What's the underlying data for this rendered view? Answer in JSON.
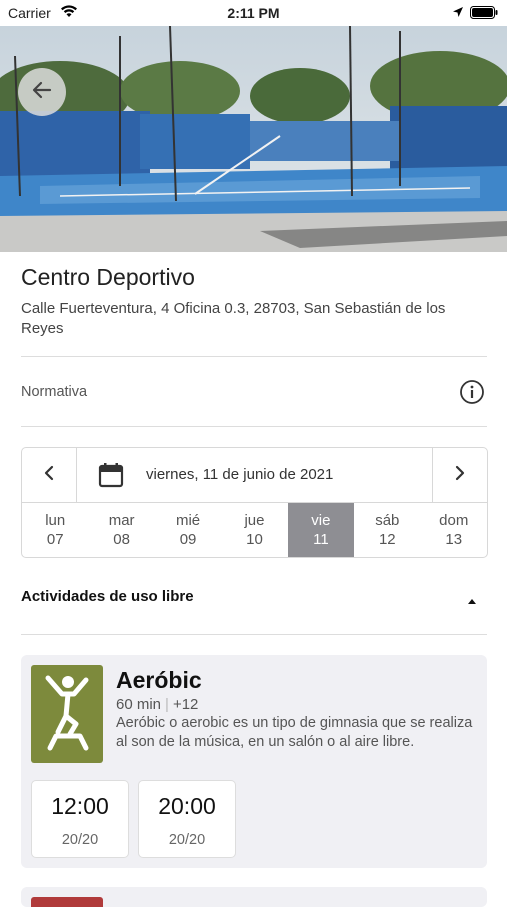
{
  "status_bar": {
    "carrier": "Carrier",
    "time": "2:11 PM"
  },
  "venue": {
    "title": "Centro Deportivo",
    "address": "Calle Fuerteventura, 4 Oficina 0.3, 28703, San Sebastián de los Reyes"
  },
  "rules": {
    "label": "Normativa"
  },
  "date_picker": {
    "current_date": "viernes, 11 de junio de 2021",
    "days": [
      {
        "name": "lun",
        "num": "07"
      },
      {
        "name": "mar",
        "num": "08"
      },
      {
        "name": "mié",
        "num": "09"
      },
      {
        "name": "jue",
        "num": "10"
      },
      {
        "name": "vie",
        "num": "11",
        "selected": true
      },
      {
        "name": "sáb",
        "num": "12"
      },
      {
        "name": "dom",
        "num": "13"
      }
    ]
  },
  "section": {
    "title": "Actividades de uso libre"
  },
  "activity": {
    "name": "Aeróbic",
    "duration": "60 min",
    "age": "+12",
    "description": "Aeróbic o aerobic es un tipo de gimnasia que se realiza al son de la música, en un salón o al aire libre.",
    "slots": [
      {
        "time": "12:00",
        "capacity": "20/20"
      },
      {
        "time": "20:00",
        "capacity": "20/20"
      }
    ]
  },
  "colors": {
    "selected_day": "#8e8e93",
    "activity_thumb": "#7d8a3c",
    "card_bg": "#f0f0f4"
  }
}
